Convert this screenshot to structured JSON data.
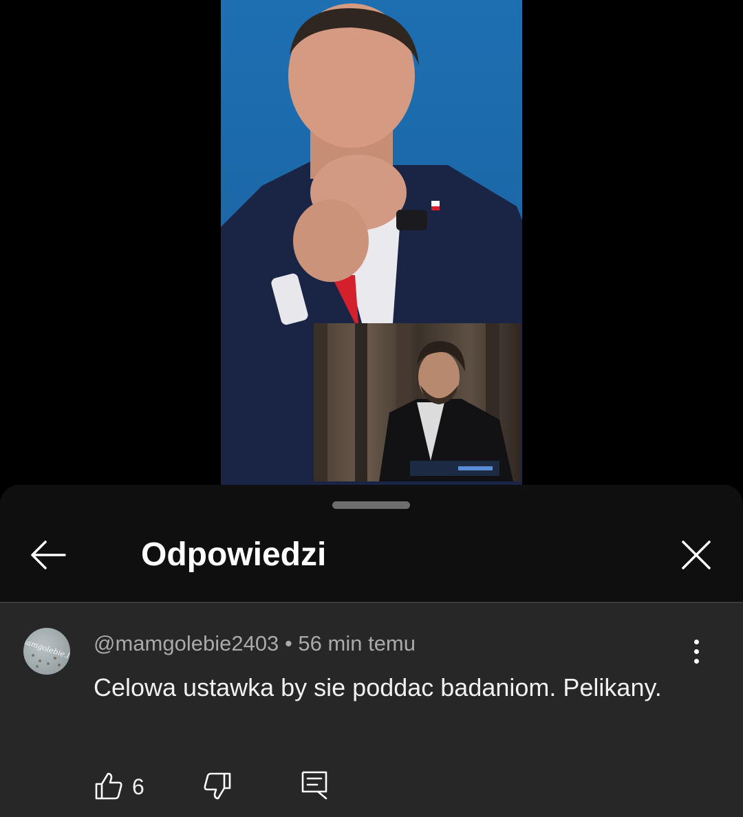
{
  "video": {
    "background": "#000000",
    "frame_color": "#1d6fb2"
  },
  "sheet": {
    "title": "Odpowiedzi",
    "back_icon": "arrow-left-icon",
    "close_icon": "close-icon"
  },
  "comment": {
    "author": "@mamgolebie2403",
    "separator": "•",
    "time": "56 min temu",
    "text": "Celowa ustawka by sie poddac badaniom. Pelikany.",
    "avatar_text": "iamgolebie.l",
    "like_count": "6",
    "icons": [
      "thumb-up-icon",
      "thumb-down-icon",
      "reply-icon",
      "more-vertical-icon"
    ]
  }
}
